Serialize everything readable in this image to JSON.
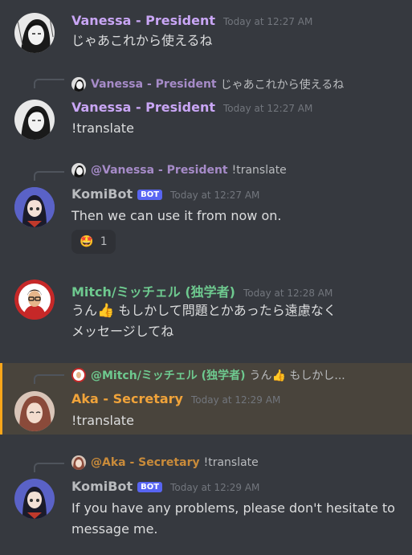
{
  "colors": {
    "background": "#36393f",
    "vanessa": "#c9a6f5",
    "bot": "#b9bbbe",
    "mitch": "#6ec98f",
    "aka": "#f0a33a",
    "mention_highlight": "#49443c",
    "bot_badge": "#5865f2"
  },
  "messages": [
    {
      "author": "Vanessa - President",
      "time": "Today at 12:27 AM",
      "text": "じゃあこれから使えるね"
    },
    {
      "reply": {
        "name": "Vanessa - President",
        "text": "じゃあこれから使えるね"
      },
      "author": "Vanessa - President",
      "time": "Today at 12:27 AM",
      "text": "!translate"
    },
    {
      "reply": {
        "name": "@Vanessa - President",
        "text": "!translate"
      },
      "author": "KomiBot",
      "badge": "BOT",
      "time": "Today at 12:27 AM",
      "text": "Then we can use it from now on.",
      "reaction": {
        "emoji": "🤩",
        "count": "1"
      }
    },
    {
      "author": "Mitch/ミッチェル (独学者)",
      "time": "Today at 12:28 AM",
      "line1_a": "うん",
      "line1_emoji": "👍",
      "line1_b": " もしかして問題とかあったら遠慮なく",
      "line2": "メッセージしてね"
    },
    {
      "reply": {
        "name": "@Mitch/ミッチェル (独学者)",
        "text_a": "うん",
        "emoji": "👍",
        "text_b": " もしかし..."
      },
      "author": "Aka - Secretary",
      "time": "Today at 12:29 AM",
      "text": "!translate"
    },
    {
      "reply": {
        "name": "@Aka - Secretary",
        "text": "!translate"
      },
      "author": "KomiBot",
      "badge": "BOT",
      "time": "Today at 12:29 AM",
      "line1": "If you have any problems, please don't hesitate to",
      "line2": "message me."
    }
  ]
}
